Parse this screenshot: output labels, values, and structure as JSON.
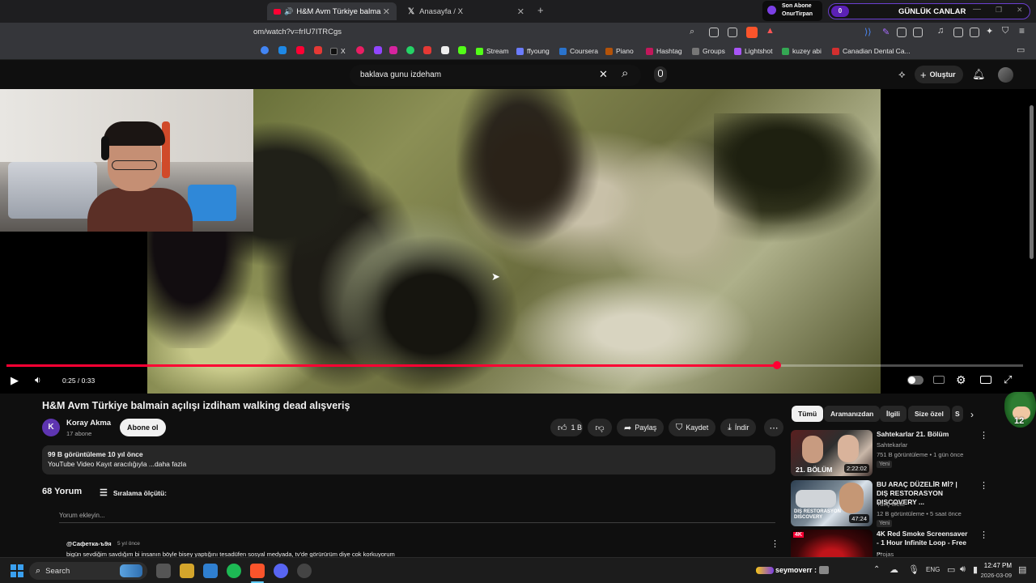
{
  "browser": {
    "tabs": [
      {
        "label": "H&M Avm Türkiye balmain a"
      },
      {
        "label": "Anasayfa / X"
      }
    ],
    "new_tab": "+",
    "url": "om/watch?v=frIU7ITRCgs",
    "bookmarks": [
      {
        "label": "X",
        "color": "#111111"
      },
      {
        "label": "Stream",
        "color": "#53fc18"
      },
      {
        "label": "ffyoung",
        "color": "#6b7cff"
      },
      {
        "label": "Coursera",
        "color": "#2a73cc"
      },
      {
        "label": "Piano",
        "color": "#b45309"
      },
      {
        "label": "Hashtag",
        "color": "#c2185b"
      },
      {
        "label": "Groups",
        "color": "#777777"
      },
      {
        "label": "Lightshot",
        "color": "#a855f7"
      },
      {
        "label": "kuzey abi",
        "color": "#34a853"
      },
      {
        "label": "Canadian Dental Ca...",
        "color": "#d32f2f"
      }
    ]
  },
  "overlay": {
    "son_abone_label": "Son Abone",
    "son_abone_name": "OnurTirpan",
    "gunluk_count": "0",
    "gunluk_label": "GÜNLÜK CANLAR"
  },
  "youtube": {
    "search_query": "baklava gunu izdeham",
    "create_label": "Oluştur"
  },
  "player": {
    "time": "0:25 / 0:33",
    "progress_fraction": 0.7576
  },
  "video": {
    "title": "H&M Avm Türkiye balmain açılışı izdiham walking dead alışveriş",
    "channel_initial": "K",
    "channel_name": "Koray Akma",
    "subscribers": "17 abone",
    "subscribe_label": "Abone ol",
    "likes": "1 B",
    "share_label": "Paylaş",
    "save_label": "Kaydet",
    "download_label": "İndir",
    "views_line": "99 B görüntüleme  10 yıl önce",
    "desc_line": "YouTube Video Kayıt aracılığıyla ...daha fazla"
  },
  "comments": {
    "count_label": "68 Yorum",
    "sort_label": "Sıralama ölçütü:",
    "add_placeholder": "Yorum ekleyin...",
    "first_author": "@Сафетка-ъ9я",
    "first_time": "5 yıl önce",
    "first_text": "bigün sevdiğim savdığım bi insanın böyle bisey yaptığını tesadüfen sosyal medyada, tv'de görürürüm diye cok korkuyorum"
  },
  "chips": [
    "Tümü",
    "Aramanızdan",
    "İlgili",
    "Size özel",
    "S"
  ],
  "recommendations": [
    {
      "title": "Sahtekarlar 21. Bölüm",
      "channel": "Sahtekarlar",
      "meta": "751 B görüntüleme • 1 gün önce",
      "badge": "Yeni",
      "duration": "2:22:02",
      "thumb_text": "21. BÖLÜM"
    },
    {
      "title": "BU ARAÇ DÜZELİR Mİ? | DIŞ RESTORASYON DISCOVERY ...",
      "channel": "Tunç Mete",
      "meta": "12 B görüntüleme • 5 saat önce",
      "badge": "Yeni",
      "duration": "47:24",
      "thumb_text": "DIŞ RESTORASYON DISCOVERY"
    },
    {
      "title": "4K Red Smoke Screensaver - 1 Hour  Infinite Loop - Free ...",
      "channel": "Projas",
      "meta": "",
      "badge": "",
      "duration": "",
      "thumb_text": "4K"
    }
  ],
  "taskbar": {
    "search_label": "Search",
    "lang": "ENG",
    "time": "12:47 PM",
    "date": "2026-03-09",
    "stream_user": "seymoverr :"
  },
  "side_badge": "12",
  "colors": {
    "accent": "#ff0033",
    "bg": "#0f0f0f",
    "chip": "#272727"
  }
}
